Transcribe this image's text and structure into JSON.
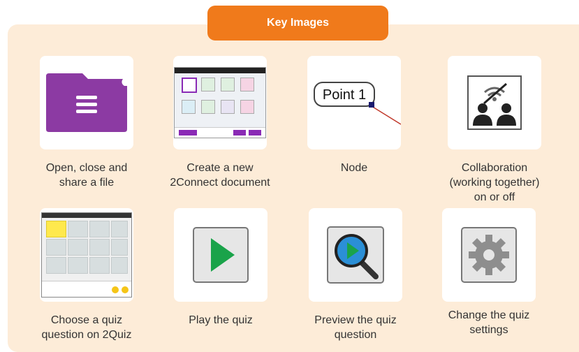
{
  "header": {
    "title": "Key Images"
  },
  "colors": {
    "accent": "#f07a1b",
    "panel": "#fdecd8",
    "purple": "#8c3aa3",
    "green": "#1aa34a"
  },
  "items": [
    {
      "icon": "file-icon",
      "label_lines": [
        "Open, close and",
        "share a file"
      ]
    },
    {
      "icon": "create-document-screenshot",
      "label_lines": [
        "Create a new",
        "2Connect document"
      ]
    },
    {
      "icon": "node-icon",
      "node_text": "Point 1",
      "label_lines": [
        "Node"
      ]
    },
    {
      "icon": "collaboration-icon",
      "label_lines": [
        "Collaboration",
        "(working together)",
        "on or off"
      ]
    },
    {
      "icon": "quiz-question-screenshot",
      "label_lines": [
        "Choose a quiz",
        "question on 2Quiz"
      ]
    },
    {
      "icon": "play-icon",
      "label_lines": [
        "Play the quiz"
      ]
    },
    {
      "icon": "preview-icon",
      "label_lines": [
        "Preview the quiz",
        "question"
      ]
    },
    {
      "icon": "settings-gear-icon",
      "label_lines": [
        "Change the quiz",
        "settings"
      ]
    }
  ]
}
